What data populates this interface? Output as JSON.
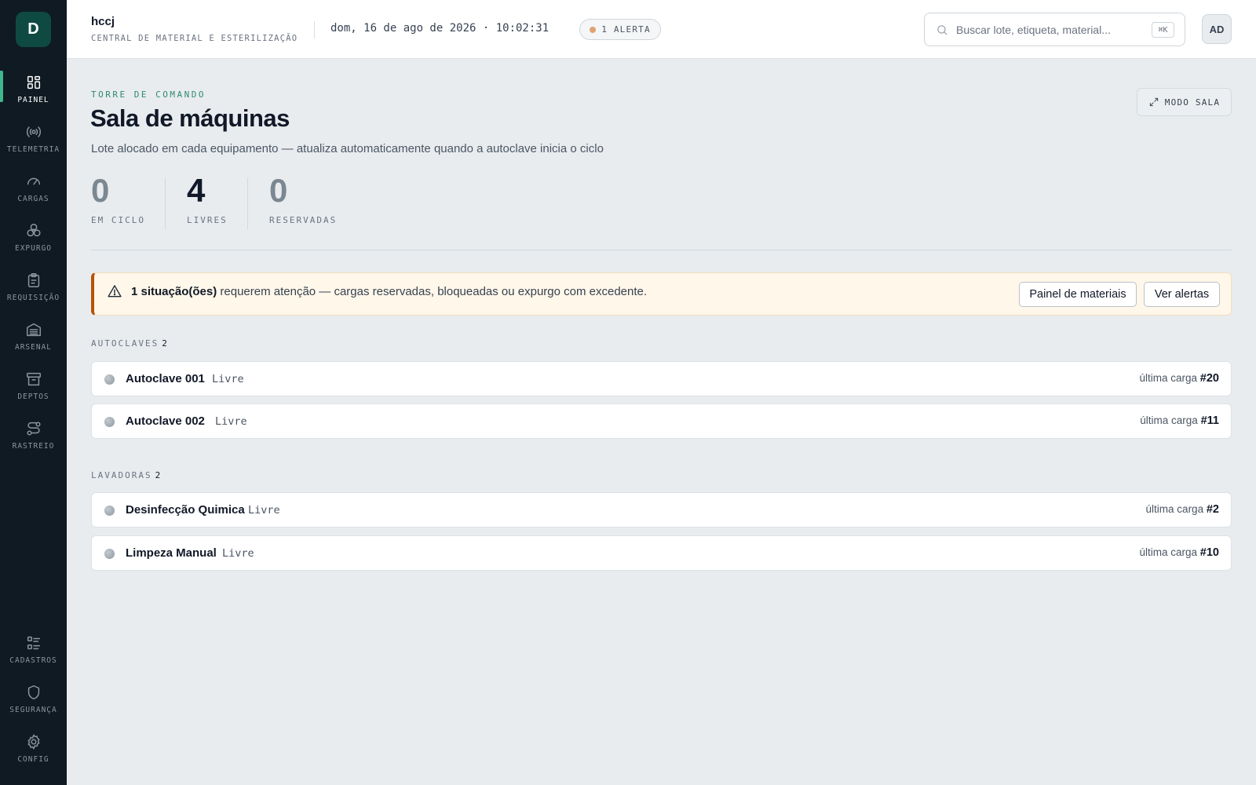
{
  "app": {
    "logo_letter": "D",
    "name": "hccj",
    "subtitle": "CENTRAL DE MATERIAL E ESTERILIZAÇÃO"
  },
  "header": {
    "datetime": "dom, 16 de ago de 2026 · 10:02:31",
    "alert_badge": "1 ALERTA",
    "search_placeholder": "Buscar lote, etiqueta, material...",
    "search_shortcut": "⌘K",
    "user_initials": "AD"
  },
  "sidebar": {
    "items": [
      {
        "label": "PAINEL",
        "icon": "grid-icon",
        "active": true
      },
      {
        "label": "TELEMETRIA",
        "icon": "signal-icon"
      },
      {
        "label": "CARGAS",
        "icon": "gauge-icon"
      },
      {
        "label": "EXPURGO",
        "icon": "biohazard-icon"
      },
      {
        "label": "REQUISIÇÃO",
        "icon": "clipboard-icon"
      },
      {
        "label": "ARSENAL",
        "icon": "warehouse-icon"
      },
      {
        "label": "DEPTOS",
        "icon": "archive-icon"
      },
      {
        "label": "RASTREIO",
        "icon": "route-icon"
      }
    ],
    "bottom_items": [
      {
        "label": "CADASTROS",
        "icon": "list-icon"
      },
      {
        "label": "SEGURANÇA",
        "icon": "shield-icon"
      },
      {
        "label": "CONFIG",
        "icon": "gear-icon"
      }
    ]
  },
  "main": {
    "eyebrow": "TORRE DE COMANDO",
    "title": "Sala de máquinas",
    "subtitle": "Lote alocado em cada equipamento — atualiza automaticamente quando a autoclave inicia o ciclo",
    "room_mode_label": "MODO SALA",
    "stats": [
      {
        "value": "0",
        "label": "EM CICLO",
        "color": "#7b8791"
      },
      {
        "value": "4",
        "label": "LIVRES",
        "color": "#111827"
      },
      {
        "value": "0",
        "label": "RESERVADAS",
        "color": "#7b8791"
      }
    ],
    "banner": {
      "bold": "1 situação(ões)",
      "text": " requerem atenção — cargas reservadas, bloqueadas ou expurgo com excedente.",
      "btn_materials": "Painel de materiais",
      "btn_alerts": "Ver alertas"
    },
    "groups": [
      {
        "label": "AUTOCLAVES",
        "count": "2",
        "machines": [
          {
            "name": "Autoclave 001",
            "status": "Livre",
            "last_label": "última carga",
            "last_load": "#20"
          },
          {
            "name": "Autoclave 002",
            "status": "Livre",
            "last_label": "última carga",
            "last_load": "#11"
          }
        ]
      },
      {
        "label": "LAVADORAS",
        "count": "2",
        "machines": [
          {
            "name": "Desinfecção Quimica",
            "status": "Livre",
            "last_label": "última carga",
            "last_load": "#2"
          },
          {
            "name": "Limpeza Manual",
            "status": "Livre",
            "last_label": "última carga",
            "last_load": "#10"
          }
        ]
      }
    ]
  }
}
